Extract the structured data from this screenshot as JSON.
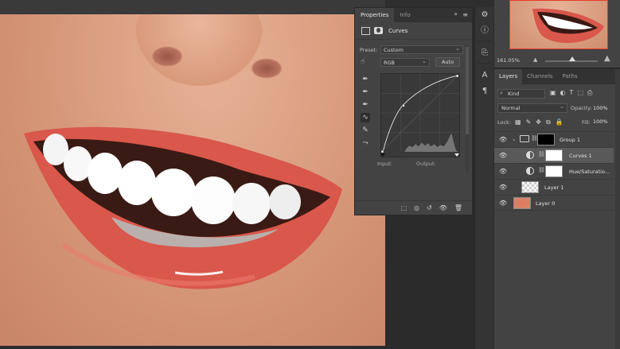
{
  "properties_panel": {
    "tabs": [
      "Properties",
      "Info"
    ],
    "active_tab": "Properties",
    "adjustment_title": "Curves",
    "preset_label": "Preset:",
    "preset_value": "Custom",
    "channel_value": "RGB",
    "auto_label": "Auto",
    "input_label": "Input:",
    "output_label": "Output:"
  },
  "navigator": {
    "zoom": "161.05%"
  },
  "layers_panel": {
    "tabs": [
      "Layers",
      "Channels",
      "Paths"
    ],
    "active_tab": "Layers",
    "filter_kind": "Kind",
    "blend_mode": "Normal",
    "opacity_label": "Opacity:",
    "opacity_value": "100%",
    "lock_label": "Lock:",
    "fill_label": "Fill:",
    "fill_value": "100%",
    "layers": [
      {
        "name": "Group 1",
        "type": "group",
        "selected": false
      },
      {
        "name": "Curves 1",
        "type": "adjustment",
        "selected": true
      },
      {
        "name": "Hue/Saturatio...",
        "type": "adjustment",
        "selected": false
      },
      {
        "name": "Layer 1",
        "type": "pixel-transparent",
        "selected": false
      },
      {
        "name": "Layer 0",
        "type": "pixel-photo",
        "selected": false
      }
    ]
  },
  "colors": {
    "panel_bg": "#434343",
    "tab_bg": "#323232",
    "selected_layer": "#595959",
    "lips": "#d9574b",
    "navigator_frame": "#e83a2a"
  }
}
